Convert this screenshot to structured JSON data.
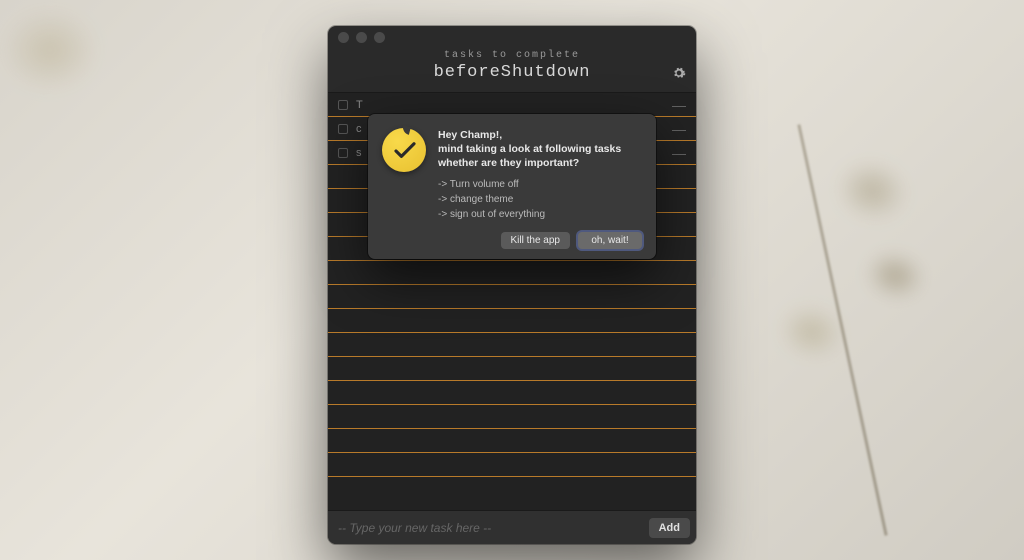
{
  "header": {
    "subtitle": "tasks to complete",
    "title": "beforeShutdown"
  },
  "list": {
    "visible_items": [
      {
        "text": "T"
      },
      {
        "text": "c"
      },
      {
        "text": "s"
      }
    ],
    "total_rows": 16
  },
  "footer": {
    "placeholder": "-- Type your new task here --",
    "add_label": "Add"
  },
  "dialog": {
    "greeting": "Hey Champ!,",
    "message": "mind taking a look at following tasks whether are they important?",
    "tasks": [
      "-> Turn volume off",
      "-> change theme",
      "-> sign out of everything"
    ],
    "buttons": {
      "kill": "Kill the app",
      "wait": "oh, wait!"
    }
  },
  "icons": {
    "gear": "gear-icon",
    "check": "check-icon"
  },
  "colors": {
    "window_bg": "#2a2a2a",
    "row_divider": "#b87a2a",
    "dialog_bg": "#3a3a3a",
    "accent_yellow": "#f2cf3d"
  }
}
